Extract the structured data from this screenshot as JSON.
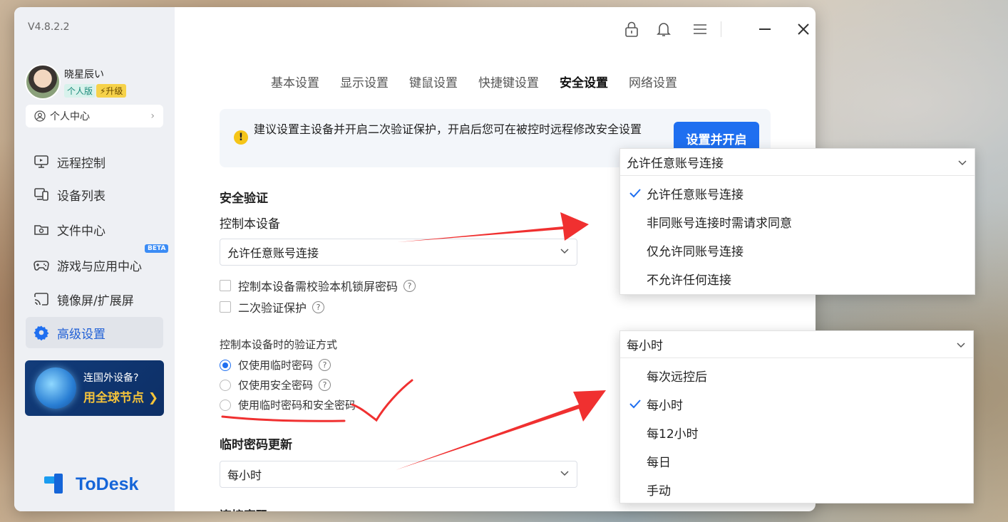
{
  "app": {
    "version": "V4.8.2.2",
    "brand": "ToDesk"
  },
  "user": {
    "name": "晓星辰い",
    "plan_badge": "个人版",
    "upgrade_badge": "⚡升级",
    "personal_center": "个人中心"
  },
  "sidebar": {
    "items": [
      {
        "label": "远程控制",
        "icon": "remote-control-icon"
      },
      {
        "label": "设备列表",
        "icon": "device-list-icon"
      },
      {
        "label": "文件中心",
        "icon": "folder-icon"
      },
      {
        "label": "游戏与应用中心",
        "icon": "gamepad-icon"
      },
      {
        "label": "镜像屏/扩展屏",
        "icon": "cast-icon"
      },
      {
        "label": "高级设置",
        "icon": "gear-icon"
      }
    ],
    "beta_badge": "BETA",
    "promo": {
      "line1": "连国外设备?",
      "line2": "用全球节点 ❯"
    }
  },
  "tabs": [
    "基本设置",
    "显示设置",
    "键鼠设置",
    "快捷键设置",
    "安全设置",
    "网络设置"
  ],
  "active_tab": "安全设置",
  "notice": {
    "text": "建议设置主设备并开启二次验证保护，开启后您可在被控时远程修改安全设置",
    "button": "设置并开启"
  },
  "security": {
    "section_title": "安全验证",
    "control_label": "控制本设备",
    "control_select_value": "允许任意账号连接",
    "checkbox_lock_password": "控制本设备需校验本机锁屏密码",
    "checkbox_2fa": "二次验证保护",
    "verify_method_label": "控制本设备时的验证方式",
    "radio_temp": "仅使用临时密码",
    "radio_secure": "仅使用安全密码",
    "radio_both": "使用临时密码和安全密码",
    "temp_pw_update_title": "临时密码更新",
    "temp_pw_update_value": "每小时",
    "cut_off_title": "连接密码"
  },
  "dropdown1": {
    "selected": "允许任意账号连接",
    "options": [
      "允许任意账号连接",
      "非同账号连接时需请求同意",
      "仅允许同账号连接",
      "不允许任何连接"
    ]
  },
  "dropdown2": {
    "selected": "每小时",
    "options": [
      "每次远控后",
      "每小时",
      "每12小时",
      "每日",
      "手动"
    ]
  },
  "colors": {
    "accent": "#1f6ff0",
    "annotation": "#f03030"
  }
}
